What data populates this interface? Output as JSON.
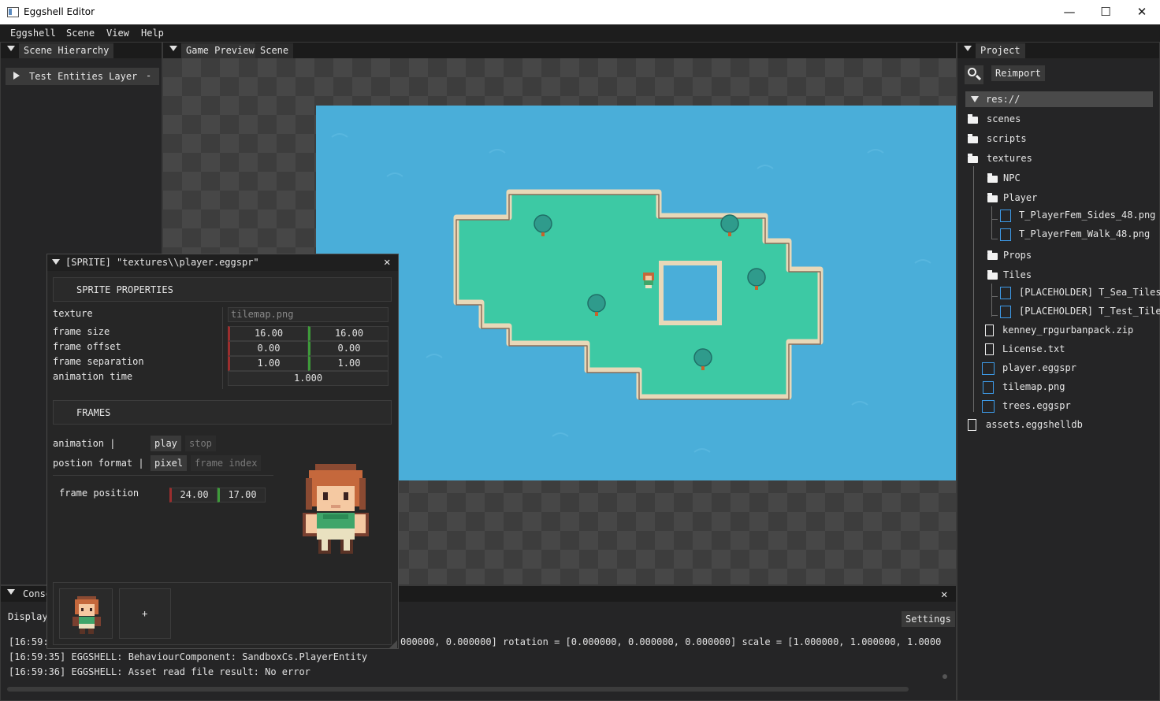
{
  "window": {
    "title": "Eggshell Editor",
    "minimize": "—",
    "maximize": "☐",
    "close": "✕"
  },
  "menubar": [
    "Eggshell",
    "Scene",
    "View",
    "Help"
  ],
  "hierarchy": {
    "tab": "Scene Hierarchy",
    "layer": "Test Entities Layer",
    "collapse": "-"
  },
  "preview": {
    "tabs": [
      "Game Preview",
      "Scene"
    ]
  },
  "project": {
    "tab": "Project",
    "reimport": "Reimport",
    "root": "res://",
    "items": [
      "scenes",
      "scripts",
      "textures",
      "NPC",
      "Player",
      "T_PlayerFem_Sides_48.png",
      "T_PlayerFem_Walk_48.png",
      "Props",
      "Tiles",
      "[PLACEHOLDER] T_Sea_Tiles",
      "[PLACEHOLDER] T_Test_Tile",
      "kenney_rpgurbanpack.zip",
      "License.txt",
      "player.eggspr",
      "tilemap.png",
      "trees.eggspr",
      "assets.eggshelldb"
    ]
  },
  "sprite": {
    "title": "[SPRITE] \"textures\\\\player.eggspr\"",
    "close": "✕",
    "section_props": "SPRITE PROPERTIES",
    "texture_label": "texture",
    "texture_value": "tilemap.png",
    "frame_size_label": "frame size",
    "frame_size": [
      "16.00",
      "16.00"
    ],
    "frame_offset_label": "frame offset",
    "frame_offset": [
      "0.00",
      "0.00"
    ],
    "frame_sep_label": "frame separation",
    "frame_sep": [
      "1.00",
      "1.00"
    ],
    "anim_time_label": "animation time",
    "anim_time": "1.000",
    "section_frames": "FRAMES",
    "animation_label": "animation      |",
    "play": "play",
    "stop": "stop",
    "position_format_label": "postion format |",
    "pixel": "pixel",
    "frame_index": "frame index",
    "frame_position_label": "frame position",
    "frame_position": [
      "24.00",
      "17.00"
    ],
    "add_frame": "+"
  },
  "console": {
    "tab": "Conso",
    "display": "Display",
    "settings": "Settings",
    "close": "✕",
    "lines": [
      "[16:59:",
      "[16:59:35] EGGSHELL:         BehaviourComponent: SandboxCs.PlayerEntity",
      "[16:59:36] EGGSHELL: Asset read file result: No error"
    ],
    "line1_right": "000000, 0.000000]    rotation = [0.000000, 0.000000, 0.000000]    scale = [1.000000, 1.000000, 1.0000"
  },
  "colors": {
    "water": "#4aaed9",
    "grass": "#3dc9a4",
    "sand": "#e8d8b8",
    "panel": "#252526"
  }
}
